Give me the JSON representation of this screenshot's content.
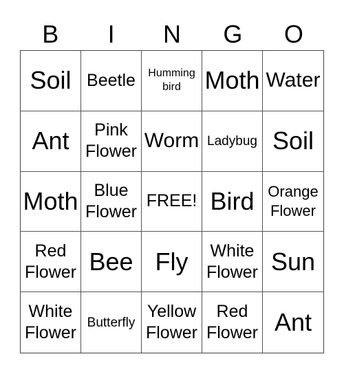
{
  "header": [
    "B",
    "I",
    "N",
    "G",
    "O"
  ],
  "cells": [
    {
      "text": "Soil",
      "size": "s-xl"
    },
    {
      "text": "Beetle",
      "size": "s-m"
    },
    {
      "text": "Humming\nbird",
      "size": "s-xs"
    },
    {
      "text": "Moth",
      "size": "s-xl"
    },
    {
      "text": "Water",
      "size": "s-l"
    },
    {
      "text": "Ant",
      "size": "s-xl"
    },
    {
      "text": "Pink\nFlower",
      "size": "s-m"
    },
    {
      "text": "Worm",
      "size": "s-l"
    },
    {
      "text": "Ladybug",
      "size": "s-s"
    },
    {
      "text": "Soil",
      "size": "s-xl"
    },
    {
      "text": "Moth",
      "size": "s-xl"
    },
    {
      "text": "Blue\nFlower",
      "size": "s-m"
    },
    {
      "text": "FREE!",
      "size": "s-m"
    },
    {
      "text": "Bird",
      "size": "s-xl"
    },
    {
      "text": "Orange\nFlower",
      "size": "s-sm"
    },
    {
      "text": "Red\nFlower",
      "size": "s-m"
    },
    {
      "text": "Bee",
      "size": "s-xl"
    },
    {
      "text": "Fly",
      "size": "s-xl"
    },
    {
      "text": "White\nFlower",
      "size": "s-m"
    },
    {
      "text": "Sun",
      "size": "s-xl"
    },
    {
      "text": "White\nFlower",
      "size": "s-m"
    },
    {
      "text": "Butterfly",
      "size": "s-s"
    },
    {
      "text": "Yellow\nFlower",
      "size": "s-m"
    },
    {
      "text": "Red\nFlower",
      "size": "s-m"
    },
    {
      "text": "Ant",
      "size": "s-xl"
    }
  ]
}
